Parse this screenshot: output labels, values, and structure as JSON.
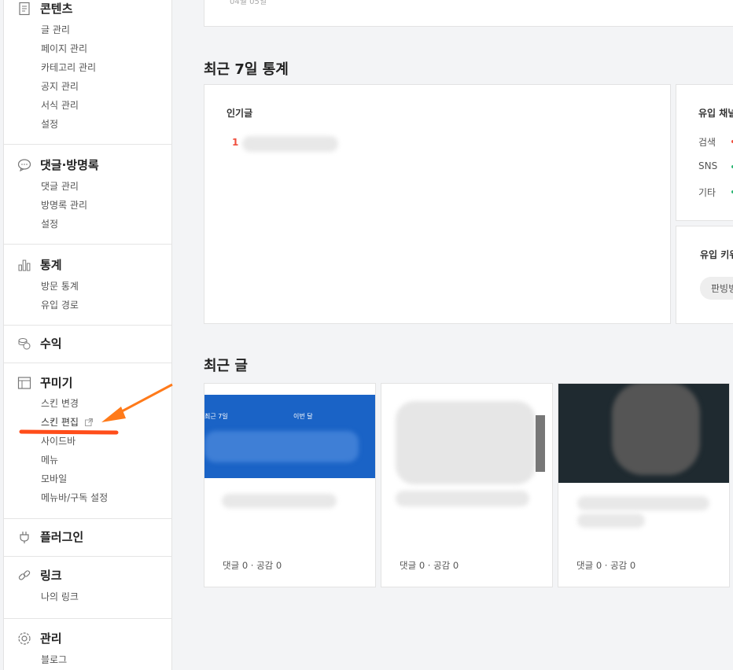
{
  "sidebar": {
    "sections": [
      {
        "title": "콘텐츠",
        "icon": "document-icon",
        "items": [
          "글 관리",
          "페이지 관리",
          "카테고리 관리",
          "공지 관리",
          "서식 관리",
          "설정"
        ]
      },
      {
        "title": "댓글·방명록",
        "icon": "comment-icon",
        "items": [
          "댓글 관리",
          "방명록 관리",
          "설정"
        ]
      },
      {
        "title": "통계",
        "icon": "bar-chart-icon",
        "items": [
          "방문 통계",
          "유입 경로"
        ]
      },
      {
        "title": "수익",
        "icon": "coins-icon",
        "items": []
      },
      {
        "title": "꾸미기",
        "icon": "layout-icon",
        "items": [
          "스킨 변경",
          "스킨 편집",
          "사이드바",
          "메뉴",
          "모바일",
          "메뉴바/구독 설정"
        ]
      },
      {
        "title": "플러그인",
        "icon": "plug-icon",
        "items": []
      },
      {
        "title": "링크",
        "icon": "link-icon",
        "items": [
          "나의 링크"
        ]
      },
      {
        "title": "관리",
        "icon": "gear-icon",
        "items": [
          "블로그"
        ]
      }
    ]
  },
  "top_card": {
    "date": "04월 05일"
  },
  "stats": {
    "heading": "최근 7일 통계",
    "popular_title": "인기글",
    "popular_rank": "1",
    "inflow_title": "유입 채널",
    "inflow_channels": [
      "검색",
      "SNS",
      "기타"
    ],
    "keyword_title": "유입 키워드",
    "keyword_chip": "판빙빙"
  },
  "recent": {
    "heading": "최근 글",
    "thumb1_label_left": "최근 7일",
    "thumb1_label_right": "이번 달",
    "posts": [
      {
        "meta": "댓글 0 · 공감 0"
      },
      {
        "meta": "댓글 0 · 공감 0"
      },
      {
        "meta": "댓글 0 · 공감 0"
      }
    ]
  },
  "colors": {
    "accent_red": "#f04f3e",
    "arrow": "#ff7a1a",
    "underline": "#ff4d1a",
    "thumb_blue": "#1a63c6"
  }
}
